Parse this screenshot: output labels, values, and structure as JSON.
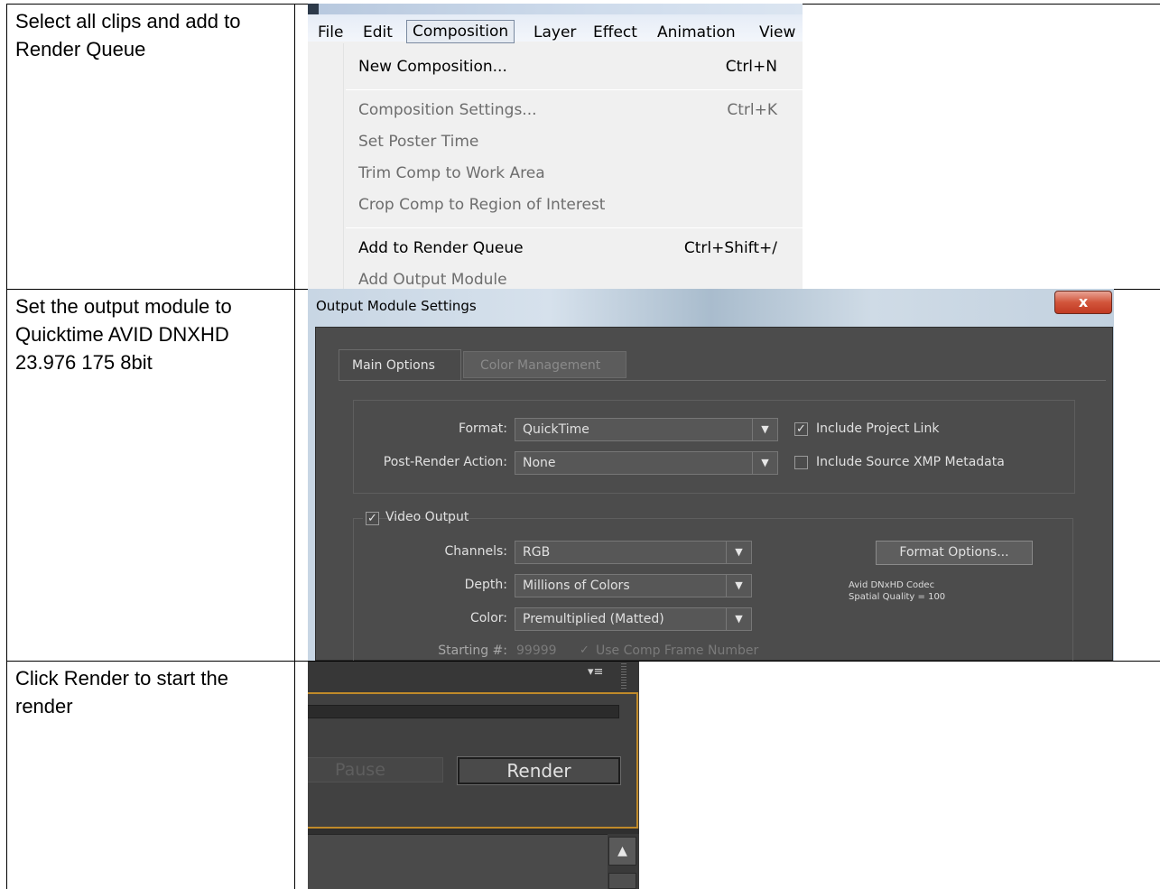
{
  "steps": [
    {
      "text": "Select all clips and add to Render Queue"
    },
    {
      "text": "Set the output module to Quicktime AVID DNXHD 23.976 175 8bit"
    },
    {
      "text": "Click Render to start the render"
    }
  ],
  "menu_screenshot": {
    "menubar": [
      "File",
      "Edit",
      "Composition",
      "Layer",
      "Effect",
      "Animation",
      "View"
    ],
    "items": [
      {
        "label": "New Composition...",
        "shortcut": "Ctrl+N",
        "enabled": true
      },
      {
        "label": "Composition Settings...",
        "shortcut": "Ctrl+K",
        "enabled": false
      },
      {
        "label": "Set Poster Time",
        "shortcut": "",
        "enabled": false
      },
      {
        "label": "Trim Comp to Work Area",
        "shortcut": "",
        "enabled": false
      },
      {
        "label": "Crop Comp to Region of Interest",
        "shortcut": "",
        "enabled": false
      },
      {
        "label": "Add to Render Queue",
        "shortcut": "Ctrl+Shift+/",
        "enabled": true
      },
      {
        "label": "Add Output Module",
        "shortcut": "",
        "enabled": false
      }
    ]
  },
  "output_module": {
    "title": "Output Module Settings",
    "close": "x",
    "tabs": [
      "Main Options",
      "Color Management"
    ],
    "format_label": "Format:",
    "format_value": "QuickTime",
    "post_render_label": "Post-Render Action:",
    "post_render_value": "None",
    "include_project_link": {
      "label": "Include Project Link",
      "checked": true
    },
    "include_xmp": {
      "label": "Include Source XMP Metadata",
      "checked": false
    },
    "video_output": {
      "label": "Video Output",
      "checked": true
    },
    "channels_label": "Channels:",
    "channels_value": "RGB",
    "depth_label": "Depth:",
    "depth_value": "Millions of Colors",
    "color_label": "Color:",
    "color_value": "Premultiplied (Matted)",
    "starting_label": "Starting #:",
    "starting_value": "99999",
    "use_comp_frame": {
      "label": "Use Comp Frame Number",
      "checked": true
    },
    "format_options_button": "Format Options...",
    "codec_line1": "Avid DNxHD Codec",
    "codec_line2": "Spatial Quality = 100"
  },
  "render_panel": {
    "pause_label": "Pause",
    "render_label": "Render",
    "panel_menu_icon": "▾≡",
    "scroll_up_icon": "▲"
  },
  "colors": {
    "menu_bg": "#f0f0f0",
    "ae_panel_bg": "#4c4c4c",
    "render_focus_border": "#c08a2a",
    "close_button": "#c9442b"
  }
}
